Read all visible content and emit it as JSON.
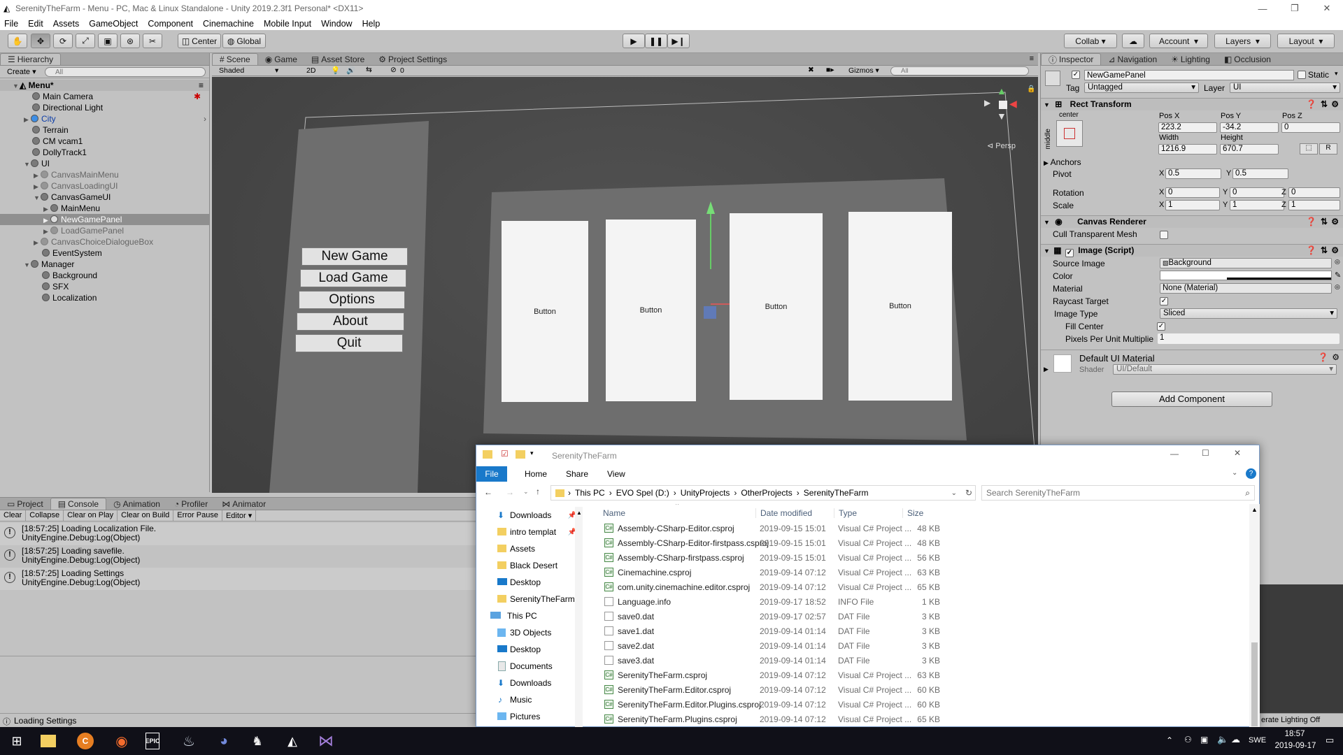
{
  "window": {
    "title": "SerenityTheFarm - Menu - PC, Mac & Linux Standalone - Unity 2019.2.3f1 Personal* <DX11>"
  },
  "menu": [
    "File",
    "Edit",
    "Assets",
    "GameObject",
    "Component",
    "Cinemachine",
    "Mobile Input",
    "Window",
    "Help"
  ],
  "toolbar": {
    "center": "Center",
    "global": "Global",
    "collab": "Collab",
    "account": "Account",
    "layers": "Layers",
    "layout": "Layout"
  },
  "hierarchy": {
    "tab": "Hierarchy",
    "create": "Create",
    "search_placeholder": "All",
    "scene": "Menu*",
    "items": [
      "Main Camera",
      "Directional Light",
      "City",
      "Terrain",
      "CM vcam1",
      "DollyTrack1",
      "UI",
      "CanvasMainMenu",
      "CanvasLoadingUI",
      "CanvasGameUI",
      "MainMenu",
      "NewGamePanel",
      "LoadGamePanel",
      "CanvasChoiceDialogueBox",
      "EventSystem",
      "Manager",
      "Background",
      "SFX",
      "Localization"
    ]
  },
  "scene": {
    "tabs": [
      "Scene",
      "Game",
      "Asset Store",
      "Project Settings"
    ],
    "shaded": "Shaded",
    "mode2d": "2D",
    "fx_count": "0",
    "gizmos": "Gizmos",
    "search_placeholder": "All",
    "persp": "Persp",
    "menu_buttons": [
      "New Game",
      "Load Game",
      "Options",
      "About",
      "Quit"
    ],
    "card_label": "Button"
  },
  "console": {
    "tabs": [
      "Project",
      "Console",
      "Animation",
      "Profiler",
      "Animator"
    ],
    "buttons": [
      "Clear",
      "Collapse",
      "Clear on Play",
      "Clear on Build",
      "Error Pause",
      "Editor"
    ],
    "logs": [
      {
        "line1": "[18:57:25] Loading Localization File.",
        "line2": "UnityEngine.Debug:Log(Object)"
      },
      {
        "line1": "[18:57:25] Loading savefile.",
        "line2": "UnityEngine.Debug:Log(Object)"
      },
      {
        "line1": "[18:57:25] Loading Settings",
        "line2": "UnityEngine.Debug:Log(Object)"
      }
    ]
  },
  "status": {
    "message": "Loading Settings",
    "lighting": "erate Lighting Off"
  },
  "inspector": {
    "tabs": [
      "Inspector",
      "Navigation",
      "Lighting",
      "Occlusion"
    ],
    "object_name": "NewGamePanel",
    "static": "Static",
    "tag_label": "Tag",
    "tag": "Untagged",
    "layer_label": "Layer",
    "layer": "UI",
    "rect_transform": "Rect Transform",
    "anchor_h": "center",
    "anchor_v": "middle",
    "pos_x_label": "Pos X",
    "pos_y_label": "Pos Y",
    "pos_z_label": "Pos Z",
    "pos_x": "223.2",
    "pos_y": "-34.2",
    "pos_z": "0",
    "width_label": "Width",
    "height_label": "Height",
    "width": "1216.9",
    "height": "670.7",
    "r": "R",
    "anchors": "Anchors",
    "pivot": "Pivot",
    "pivot_x": "0.5",
    "pivot_y": "0.5",
    "rotation": "Rotation",
    "rot_x": "0",
    "rot_y": "0",
    "rot_z": "0",
    "scale": "Scale",
    "scale_x": "1",
    "scale_y": "1",
    "scale_z": "1",
    "x": "X",
    "y": "Y",
    "z": "Z",
    "canvas_renderer": "Canvas Renderer",
    "cull": "Cull Transparent Mesh",
    "image_script": "Image (Script)",
    "source_image_label": "Source Image",
    "source_image": "Background",
    "color_label": "Color",
    "material_label": "Material",
    "material": "None (Material)",
    "raycast": "Raycast Target",
    "image_type_label": "Image Type",
    "image_type": "Sliced",
    "fill_center": "Fill Center",
    "ppu_label": "Pixels Per Unit Multiplie",
    "ppu": "1",
    "default_material": "Default UI Material",
    "shader_label": "Shader",
    "shader": "UI/Default",
    "add_component": "Add Component"
  },
  "explorer": {
    "title": "SerenityTheFarm",
    "ribbon": [
      "File",
      "Home",
      "Share",
      "View"
    ],
    "breadcrumb": [
      "This PC",
      "EVO Spel (D:)",
      "UnityProjects",
      "OtherProjects",
      "SerenityTheFarm"
    ],
    "search_placeholder": "Search SerenityTheFarm",
    "nav": [
      "Downloads",
      "intro templat",
      "Assets",
      "Black Desert",
      "Desktop",
      "SerenityTheFarm",
      "This PC",
      "3D Objects",
      "Desktop",
      "Documents",
      "Downloads",
      "Music",
      "Pictures"
    ],
    "columns": [
      "Name",
      "Date modified",
      "Type",
      "Size"
    ],
    "files": [
      {
        "name": "Assembly-CSharp-Editor.csproj",
        "date": "2019-09-15 15:01",
        "type": "Visual C# Project ...",
        "size": "48 KB",
        "icon": "cs"
      },
      {
        "name": "Assembly-CSharp-Editor-firstpass.csproj",
        "date": "2019-09-15 15:01",
        "type": "Visual C# Project ...",
        "size": "48 KB",
        "icon": "cs"
      },
      {
        "name": "Assembly-CSharp-firstpass.csproj",
        "date": "2019-09-15 15:01",
        "type": "Visual C# Project ...",
        "size": "56 KB",
        "icon": "cs"
      },
      {
        "name": "Cinemachine.csproj",
        "date": "2019-09-14 07:12",
        "type": "Visual C# Project ...",
        "size": "63 KB",
        "icon": "cs"
      },
      {
        "name": "com.unity.cinemachine.editor.csproj",
        "date": "2019-09-14 07:12",
        "type": "Visual C# Project ...",
        "size": "65 KB",
        "icon": "cs"
      },
      {
        "name": "Language.info",
        "date": "2019-09-17 18:52",
        "type": "INFO File",
        "size": "1 KB",
        "icon": "doc"
      },
      {
        "name": "save0.dat",
        "date": "2019-09-17 02:57",
        "type": "DAT File",
        "size": "3 KB",
        "icon": "doc"
      },
      {
        "name": "save1.dat",
        "date": "2019-09-14 01:14",
        "type": "DAT File",
        "size": "3 KB",
        "icon": "doc"
      },
      {
        "name": "save2.dat",
        "date": "2019-09-14 01:14",
        "type": "DAT File",
        "size": "3 KB",
        "icon": "doc"
      },
      {
        "name": "save3.dat",
        "date": "2019-09-14 01:14",
        "type": "DAT File",
        "size": "3 KB",
        "icon": "doc"
      },
      {
        "name": "SerenityTheFarm.csproj",
        "date": "2019-09-14 07:12",
        "type": "Visual C# Project ...",
        "size": "63 KB",
        "icon": "cs"
      },
      {
        "name": "SerenityTheFarm.Editor.csproj",
        "date": "2019-09-14 07:12",
        "type": "Visual C# Project ...",
        "size": "60 KB",
        "icon": "cs"
      },
      {
        "name": "SerenityTheFarm.Editor.Plugins.csproj",
        "date": "2019-09-14 07:12",
        "type": "Visual C# Project ...",
        "size": "60 KB",
        "icon": "cs"
      },
      {
        "name": "SerenityTheFarm.Plugins.csproj",
        "date": "2019-09-14 07:12",
        "type": "Visual C# Project ...",
        "size": "65 KB",
        "icon": "cs"
      }
    ]
  },
  "taskbar": {
    "lang": "SWE",
    "time": "18:57",
    "date": "2019-09-17"
  },
  "colors": {
    "editor_bg": "#c2c2c2",
    "scene_bg": "#4a4a4a",
    "selection": "#8f8f8f",
    "taskbar": "#101018",
    "explorer_accent": "#1979ca"
  }
}
